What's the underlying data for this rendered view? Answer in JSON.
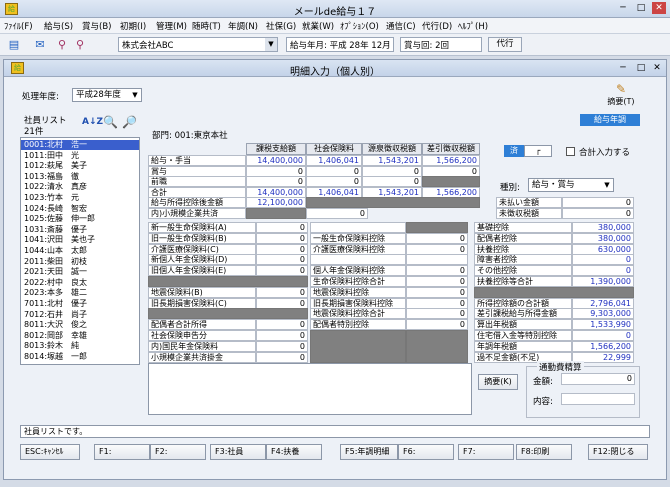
{
  "window": {
    "title": "メールde給与１７",
    "minimize": "─",
    "maximize": "□",
    "close": "✕"
  },
  "menu": [
    "ﾌｧｲﾙ(F)",
    "給与(S)",
    "賞与(B)",
    "初期(I)",
    "管理(M)",
    "随時(T)",
    "年調(N)",
    "社保(G)",
    "就業(W)",
    "ｵﾌﾟｼｮﾝ(O)",
    "通信(C)",
    "代行(D)",
    "ﾍﾙﾌﾟ(H)"
  ],
  "toolbar": {
    "company": "株式会社ABC",
    "pay_month": "給与年月: 平成 28年 12月",
    "pay_count": "賞与回: 2回",
    "agent_button": "代行"
  },
  "inner": {
    "title": "明細入力（個人別）",
    "year_label": "処理年度:",
    "year_value": "平成28年度",
    "summary_button": "摘要(T)"
  },
  "list": {
    "title": "社員リスト",
    "count": "21件",
    "employees": [
      "0001:北村　浩一",
      "1011:田中　光",
      "1012:萩尾　美子",
      "1013:福島　徹",
      "1022:清水　真彦",
      "1023:竹本　元",
      "1024:長崎　智宏",
      "1025:佐藤　伸一郎",
      "1031:斎藤　優子",
      "1041:沢田　美也子",
      "1044:山本　太郎",
      "2011:柴田　初枝",
      "2021:天田　誠一",
      "2022:村中　良太",
      "2023:本多　雄二",
      "7011:北村　優子",
      "7012:石井　尚子",
      "8011:大沢　俊之",
      "8012:岡部　幸雄",
      "8013:鈴木　純",
      "8014:塚越　一郎"
    ]
  },
  "dept": "部門: 001:東京本社",
  "tab_label": "給与年調",
  "top_grid": {
    "headers": [
      "課税支給額",
      "社会保険料",
      "源泉徴収税額",
      "差引徴収税額"
    ],
    "rows": [
      {
        "label": "給与・手当",
        "values": [
          "14,400,000",
          "1,406,041",
          "1,543,201",
          "1,566,200"
        ]
      },
      {
        "label": "賞与",
        "values": [
          "0",
          "0",
          "0",
          "0"
        ]
      },
      {
        "label": "前職",
        "values": [
          "0",
          "0",
          "0",
          ""
        ]
      },
      {
        "label": "合計",
        "values": [
          "14,400,000",
          "1,406,041",
          "1,543,201",
          "1,566,200"
        ]
      }
    ],
    "extra1_label": "給与所得控除後金額",
    "extra1_value": "12,100,000",
    "extra2_label": "内)小規模企業共済",
    "extra2_value": "0"
  },
  "checks": {
    "done_label": "済",
    "total_label": "合計入力する"
  },
  "kind": {
    "label": "種別:",
    "value": "給与・賞与"
  },
  "unpaid": [
    {
      "label": "未払い金額",
      "value": "0"
    },
    {
      "label": "未徴収税額",
      "value": "0"
    }
  ],
  "col1": [
    {
      "label": "新一般生命保険料(A)",
      "value": "0"
    },
    {
      "label": "旧一般生命保険料(B)",
      "value": "0"
    },
    {
      "label": "介護医療保険料(C)",
      "value": "0"
    },
    {
      "label": "新個人年金保険料(D)",
      "value": "0"
    },
    {
      "label": "旧個人年金保険料(E)",
      "value": "0"
    },
    {
      "label": "",
      "value": ""
    },
    {
      "label": "地震保険料(B)",
      "value": "0"
    },
    {
      "label": "旧長期損害保険料(C)",
      "value": "0"
    },
    {
      "label": "",
      "value": ""
    },
    {
      "label": "配偶者合計所得",
      "value": "0"
    },
    {
      "label": "社会保険申告分",
      "value": "0"
    },
    {
      "label": "内)国民年金保険料",
      "value": "0"
    },
    {
      "label": "小規模企業共済掛金",
      "value": "0"
    }
  ],
  "col2": [
    {
      "label": "",
      "value": ""
    },
    {
      "label": "一般生命保険料控除",
      "value": "0"
    },
    {
      "label": "介護医療保険料控除",
      "value": "0"
    },
    {
      "label": "",
      "value": ""
    },
    {
      "label": "個人年金保険料控除",
      "value": "0"
    },
    {
      "label": "生命保険料控除合計",
      "value": "0"
    },
    {
      "label": "地震保険料控除",
      "value": "0"
    },
    {
      "label": "旧長期損害保険料控除",
      "value": "0"
    },
    {
      "label": "地震保険料控除合計",
      "value": "0"
    },
    {
      "label": "配偶者特別控除",
      "value": "0"
    }
  ],
  "col3": [
    {
      "label": "基礎控除",
      "value": "380,000"
    },
    {
      "label": "配偶者控除",
      "value": "380,000"
    },
    {
      "label": "扶養控除",
      "value": "630,000"
    },
    {
      "label": "障害者控除",
      "value": "0"
    },
    {
      "label": "その他控除",
      "value": "0"
    },
    {
      "label": "扶養控除等合計",
      "value": "1,390,000"
    },
    {
      "label": "",
      "value": ""
    },
    {
      "label": "所得控除額の合計額",
      "value": "2,796,041"
    },
    {
      "label": "差引課税給与所得金額",
      "value": "9,303,000"
    },
    {
      "label": "算出年税額",
      "value": "1,533,990"
    },
    {
      "label": "住宅借入金等特別控除",
      "value": "0"
    },
    {
      "label": "年調年税額",
      "value": "1,566,200"
    },
    {
      "label": "過不足金額(不足)",
      "value": "22,999"
    }
  ],
  "memo_button": "摘要(K)",
  "commute": {
    "title": "通勤費精算",
    "amount_label": "金額:",
    "amount_value": "0",
    "content_label": "内容:"
  },
  "status": "社員リストです。",
  "fkeys": [
    "ESC:ｷｬﾝｾﾙ",
    "F1:",
    "F2:",
    "F3:社員",
    "F4:扶養",
    "F5:年調明細",
    "F6:",
    "F7:",
    "F8:印刷",
    "F12:閉じる"
  ]
}
